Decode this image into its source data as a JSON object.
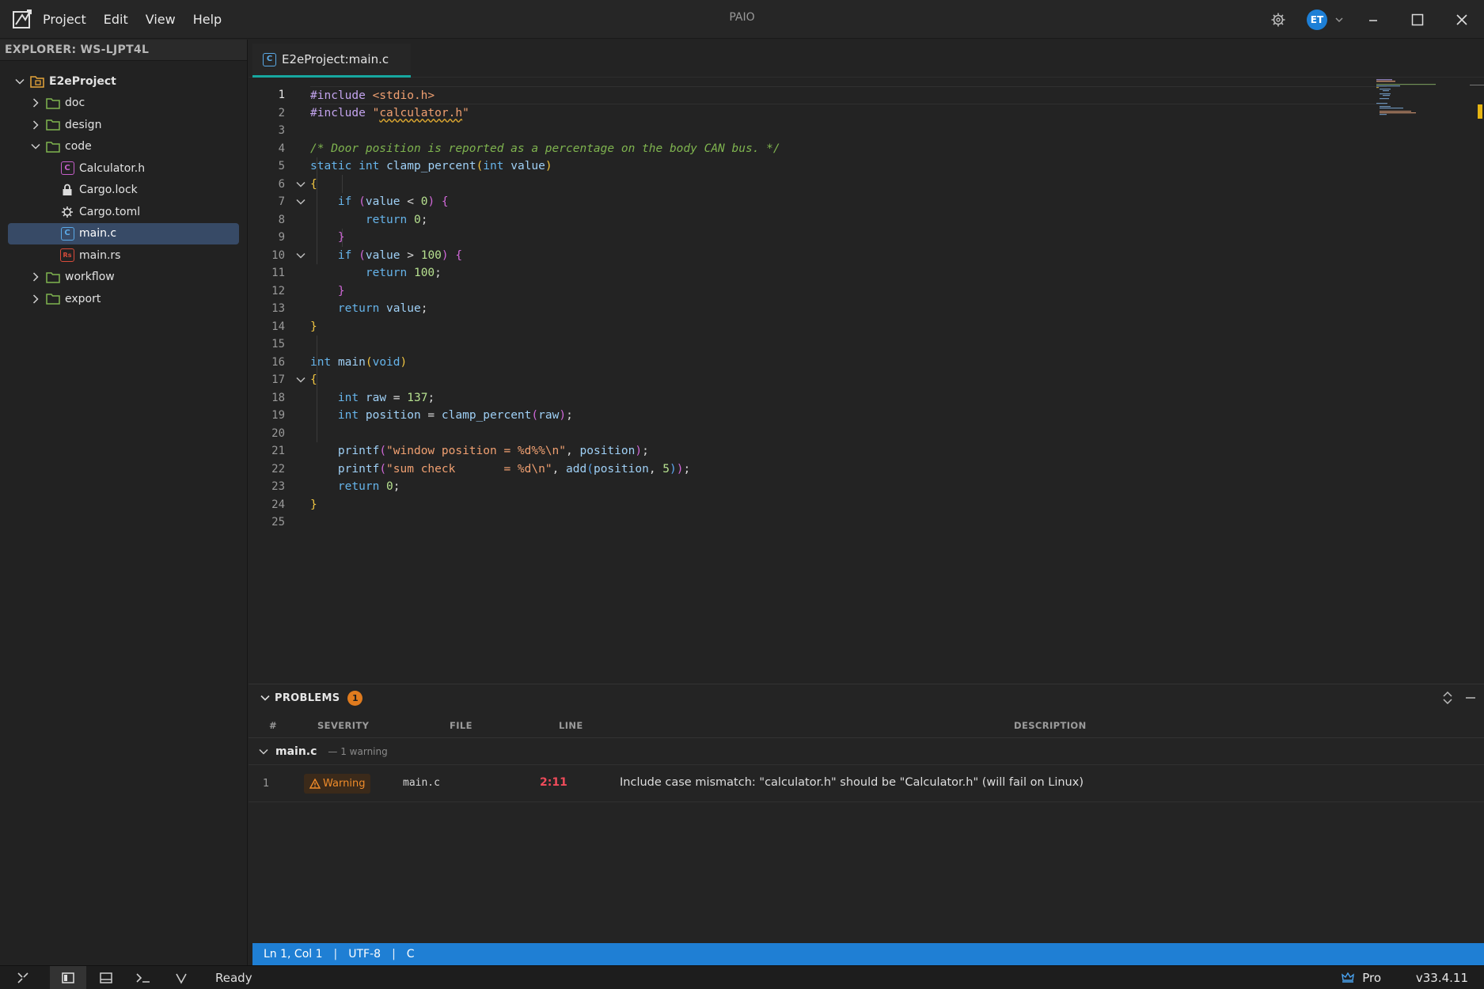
{
  "app": {
    "title": "PAIO",
    "menu": [
      "Project",
      "Edit",
      "View",
      "Help"
    ],
    "user_initials": "ET"
  },
  "sidebar": {
    "title": "EXPLORER: WS-LJPT4L",
    "tree": [
      {
        "label": "E2eProject",
        "depth": 0,
        "type": "project",
        "expanded": true
      },
      {
        "label": "doc",
        "depth": 1,
        "type": "folder",
        "expanded": false
      },
      {
        "label": "design",
        "depth": 1,
        "type": "folder",
        "expanded": false
      },
      {
        "label": "code",
        "depth": 1,
        "type": "folder",
        "expanded": true
      },
      {
        "label": "Calculator.h",
        "depth": 2,
        "type": "c-header"
      },
      {
        "label": "Cargo.lock",
        "depth": 2,
        "type": "lock"
      },
      {
        "label": "Cargo.toml",
        "depth": 2,
        "type": "gear"
      },
      {
        "label": "main.c",
        "depth": 2,
        "type": "c-file",
        "selected": true
      },
      {
        "label": "main.rs",
        "depth": 2,
        "type": "rust"
      },
      {
        "label": "workflow",
        "depth": 1,
        "type": "folder",
        "expanded": false
      },
      {
        "label": "export",
        "depth": 1,
        "type": "folder",
        "expanded": false
      }
    ]
  },
  "editor": {
    "tab_label": "E2eProject:main.c",
    "line_numbers": [
      "1",
      "2",
      "3",
      "4",
      "5",
      "6",
      "7",
      "8",
      "9",
      "10",
      "11",
      "12",
      "13",
      "14",
      "15",
      "16",
      "17",
      "18",
      "19",
      "20",
      "21",
      "22",
      "23",
      "24",
      "25"
    ],
    "fold_lines": [
      6,
      7,
      10,
      17
    ],
    "code": {
      "l1_a": "#include ",
      "l1_b": "<stdio.h>",
      "l2_a": "#include ",
      "l2_q1": "\"",
      "l2_b": "calculator.h",
      "l2_q2": "\"",
      "l4": "/* Door position is reported as a percentage on the body CAN bus. */",
      "kw_static": "static",
      "kw_int": "int",
      "kw_if": "if",
      "kw_return": "return",
      "kw_void": "void",
      "fn_clamp": "clamp_percent",
      "fn_main": "main",
      "fn_printf": "printf",
      "fn_add": "add",
      "id_value": "value",
      "id_raw": "raw",
      "id_position": "position",
      "open_paren": "(",
      "close_paren": ")",
      "open_brace": "{",
      "close_brace": "}",
      "lt": " < ",
      "gt": " > ",
      "semicolon": ";",
      "eq": " = ",
      "comma": ", ",
      "num_0": "0",
      "num_100": "100",
      "num_137": "137",
      "num_5": "5",
      "str_window": "\"window position = %d%%\\n\"",
      "str_sum": "\"sum check       = %d\\n\""
    }
  },
  "problems": {
    "title": "PROBLEMS",
    "count": "1",
    "columns": {
      "num": "#",
      "severity": "SEVERITY",
      "file": "FILE",
      "line": "LINE",
      "description": "DESCRIPTION"
    },
    "group": {
      "file": "main.c",
      "summary": "— 1 warning"
    },
    "issues": [
      {
        "num": "1",
        "severity": "Warning",
        "file": "main.c",
        "line": "2:11",
        "description": "Include case mismatch: \"calculator.h\" should be \"Calculator.h\" (will fail on Linux)"
      }
    ]
  },
  "editor_status": {
    "cursor": "Ln 1, Col 1",
    "encoding": "UTF-8",
    "language": "C",
    "sep": "|"
  },
  "statusbar": {
    "state": "Ready",
    "plan": "Pro",
    "version": "v33.4.11"
  },
  "colors": {
    "accent": "#1f7fd4",
    "tab_underline": "#17a8a0",
    "warning": "#f08c2a",
    "error": "#ee4b5a",
    "selection": "#374a66"
  }
}
